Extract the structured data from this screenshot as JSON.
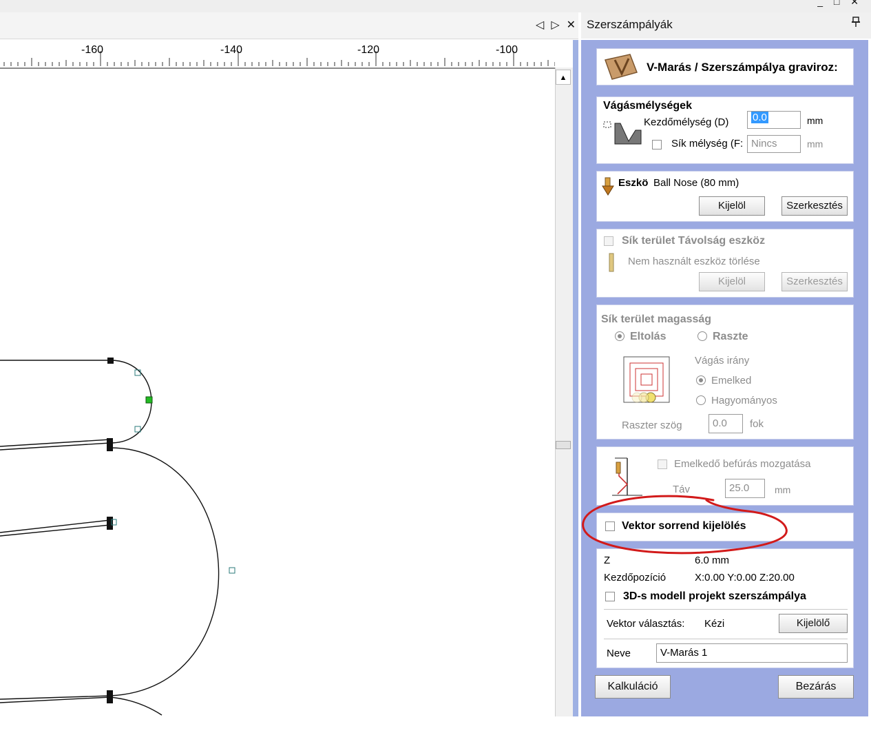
{
  "window": {
    "controls": "_ □ ✕"
  },
  "document": {
    "nav_left": "◁",
    "nav_right": "▷",
    "close": "✕"
  },
  "ruler": {
    "ticks": [
      "-160",
      "-140",
      "-120",
      "-100"
    ]
  },
  "panel": {
    "title": "Szerszámpályák",
    "header": {
      "title": "V-Marás / Szerszámpálya graviroz:"
    },
    "cut_depths": {
      "title": "Vágásmélységek",
      "start_depth_label": "Kezdőmélység (D)",
      "start_depth_value": "0.0",
      "start_depth_unit": "mm",
      "flat_depth_label": "Sík mélység (F:",
      "flat_depth_value": "Nincs",
      "flat_depth_unit": "mm"
    },
    "tool": {
      "label": "Eszkö",
      "value": "Ball Nose (80 mm)",
      "select_label": "Kijelöl",
      "edit_label": "Szerkesztés"
    },
    "flat_area_tool": {
      "title": "Sík terület Távolság eszköz",
      "clear_label": "Nem használt eszköz törlése",
      "select_label": "Kijelöl",
      "edit_label": "Szerkesztés"
    },
    "flat_area_height": {
      "title": "Sík terület magasság",
      "offset_label": "Eltolás",
      "raster_label": "Raszte",
      "cut_direction_label": "Vágás irány",
      "climb_label": "Emelked",
      "conventional_label": "Hagyományos",
      "raster_angle_label": "Raszter szög",
      "raster_angle_value": "0.0",
      "raster_angle_unit": "fok"
    },
    "ramp": {
      "label": "Emelkedő befúrás mozgatása",
      "distance_label": "Táv",
      "distance_value": "25.0",
      "distance_unit": "mm"
    },
    "vector_order": {
      "label": "Vektor sorrend kijelölés"
    },
    "summary": {
      "z_label": "Z",
      "z_value": "6.0 mm",
      "start_pos_label": "Kezdőpozíció",
      "start_pos_value": "X:0.00 Y:0.00 Z:20.00",
      "model_label": "3D-s modell projekt szerszámpálya",
      "vector_selection_label": "Vektor választás:",
      "vector_selection_value": "Kézi",
      "vector_select_button": "Kijelölő",
      "name_label": "Neve",
      "name_value": "V-Marás 1"
    },
    "calculate_label": "Kalkuláció",
    "close_label": "Bezárás"
  },
  "colors": {
    "panel_bg": "#9ba9e1",
    "highlight": "#d21a1a",
    "selection": "#3399ff",
    "node_green": "#22bb22"
  }
}
